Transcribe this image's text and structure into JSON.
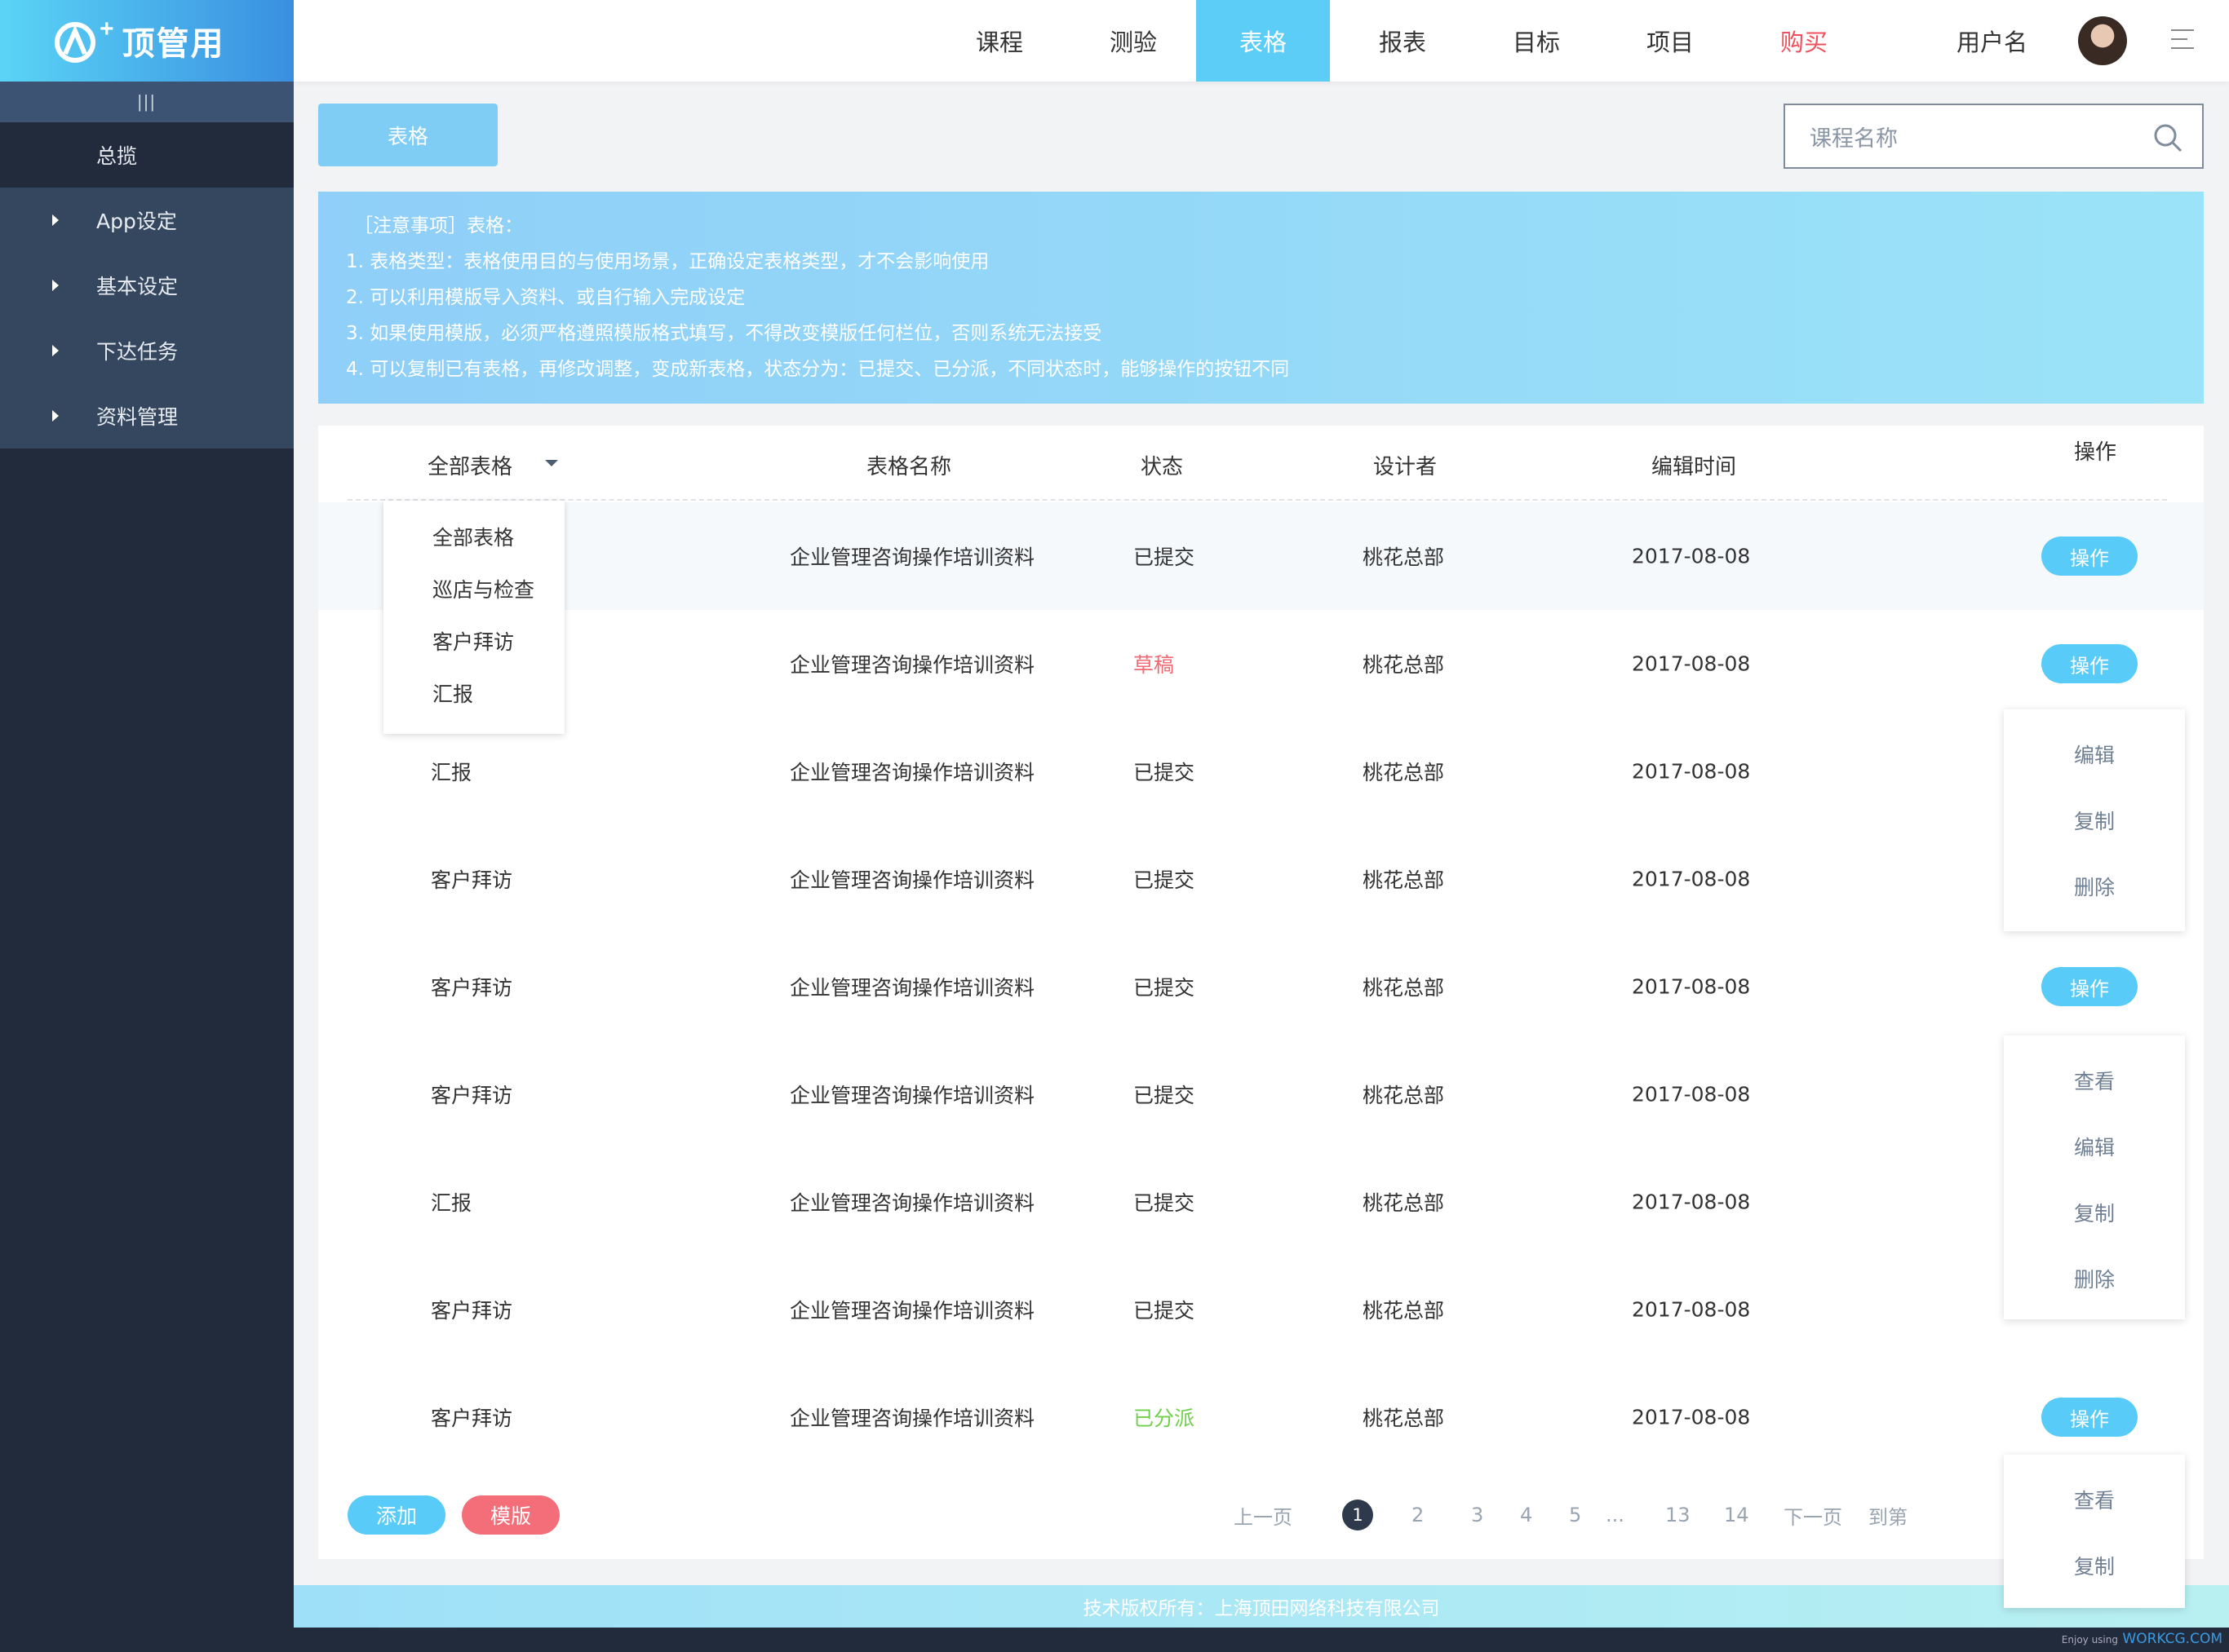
{
  "app": {
    "brand": "顶管用",
    "brand_plus": "+"
  },
  "nav": {
    "items": [
      "课程",
      "测验",
      "表格",
      "报表",
      "目标",
      "项目",
      "购买"
    ],
    "active": "表格",
    "username": "用户名"
  },
  "sidebar": {
    "toggle": "|||",
    "items": [
      {
        "label": "总揽"
      },
      {
        "label": "App设定"
      },
      {
        "label": "基本设定"
      },
      {
        "label": "下达任务"
      },
      {
        "label": "资料管理"
      }
    ]
  },
  "toolbar": {
    "tab_button": "表格",
    "search_placeholder": "课程名称"
  },
  "notice": {
    "head": "［注意事项］表格：",
    "lines": [
      "1. 表格类型：表格使用目的与使用场景，正确设定表格类型，才不会影响使用",
      "2. 可以利用模版导入资料、或自行输入完成设定",
      "3. 如果使用模版，必须严格遵照模版格式填写，不得改变模版任何栏位，否则系统无法接受",
      "4. 可以复制已有表格，再修改调整，变成新表格，状态分为：已提交、已分派，不同状态时，能够操作的按钮不同"
    ]
  },
  "table": {
    "headers": {
      "type": "全部表格",
      "name": "表格名称",
      "status": "状态",
      "designer": "设计者",
      "time": "编辑时间",
      "op": "操作"
    },
    "filter_options": [
      "全部表格",
      "巡店与检查",
      "客户拜访",
      "汇报"
    ],
    "rows": [
      {
        "type": "",
        "name": "企业管理咨询操作培训资料",
        "status": "已提交",
        "designer": "桃花总部",
        "time": "2017-08-08",
        "op": "操作"
      },
      {
        "type": "",
        "name": "企业管理咨询操作培训资料",
        "status": "草稿",
        "designer": "桃花总部",
        "time": "2017-08-08",
        "op": "操作"
      },
      {
        "type": "汇报",
        "name": "企业管理咨询操作培训资料",
        "status": "已提交",
        "designer": "桃花总部",
        "time": "2017-08-08",
        "op": ""
      },
      {
        "type": "客户拜访",
        "name": "企业管理咨询操作培训资料",
        "status": "已提交",
        "designer": "桃花总部",
        "time": "2017-08-08",
        "op": ""
      },
      {
        "type": "客户拜访",
        "name": "企业管理咨询操作培训资料",
        "status": "已提交",
        "designer": "桃花总部",
        "time": "2017-08-08",
        "op": "操作"
      },
      {
        "type": "客户拜访",
        "name": "企业管理咨询操作培训资料",
        "status": "已提交",
        "designer": "桃花总部",
        "time": "2017-08-08",
        "op": ""
      },
      {
        "type": "汇报",
        "name": "企业管理咨询操作培训资料",
        "status": "已提交",
        "designer": "桃花总部",
        "time": "2017-08-08",
        "op": ""
      },
      {
        "type": "客户拜访",
        "name": "企业管理咨询操作培训资料",
        "status": "已提交",
        "designer": "桃花总部",
        "time": "2017-08-08",
        "op": ""
      },
      {
        "type": "客户拜访",
        "name": "企业管理咨询操作培训资料",
        "status": "已分派",
        "designer": "桃花总部",
        "time": "2017-08-08",
        "op": "操作"
      }
    ],
    "op_menu_draft": [
      "编辑",
      "复制",
      "删除"
    ],
    "op_menu_submitted": [
      "查看",
      "编辑",
      "复制",
      "删除"
    ],
    "op_menu_dispatched": [
      "查看",
      "复制"
    ]
  },
  "actions": {
    "add": "添加",
    "template": "模版"
  },
  "pagination": {
    "prev": "上一页",
    "pages": [
      "1",
      "2",
      "3",
      "4",
      "5",
      "...",
      "13",
      "14"
    ],
    "current": "1",
    "next": "下一页",
    "goto": "到第"
  },
  "footer": {
    "copyright": "技术版权所有：上海顶田网络科技有限公司"
  },
  "watermark": {
    "prefix": "Enjoy using",
    "site": "WORKCG.COM"
  },
  "colors": {
    "accent": "#5ccdf7",
    "danger": "#f36e78",
    "draft": "#f06a73",
    "dispatched": "#6fd04a",
    "sidebar": "#222b3c"
  }
}
